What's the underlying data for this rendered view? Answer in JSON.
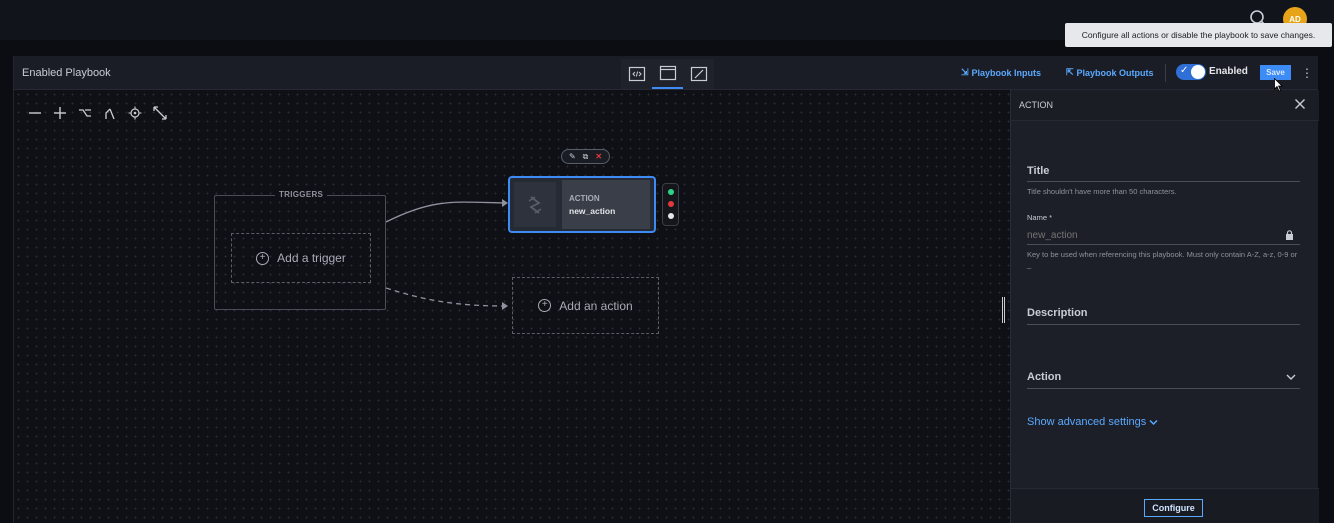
{
  "topbar": {
    "avatar_initials": "AD"
  },
  "header": {
    "title": "Enabled Playbook",
    "playbook_inputs_label": "Playbook Inputs",
    "playbook_outputs_label": "Playbook Outputs",
    "enabled_label": "Enabled",
    "enabled": true,
    "save_label": "Save",
    "tooltip": "Configure all actions or disable the playbook to save changes."
  },
  "canvas": {
    "triggers_label": "TRIGGERS",
    "add_trigger_label": "Add a trigger",
    "add_action_label": "Add an action",
    "node": {
      "type_label": "ACTION",
      "name": "new_action"
    }
  },
  "panel": {
    "title": "ACTION",
    "title_field_label": "Title",
    "title_hint": "Title shouldn't have more than 50 characters.",
    "name_label": "Name *",
    "name_placeholder": "new_action",
    "name_hint": "Key to be used when referencing this playbook. Must only contain A-Z, a-z, 0-9 or _",
    "description_label": "Description",
    "action_label": "Action",
    "advanced_label": "Show advanced settings",
    "configure_label": "Configure"
  },
  "colors": {
    "accent": "#3d8bf5",
    "link": "#5aa9ff",
    "avatar": "#e8a418",
    "success": "#2bd48a",
    "error": "#e5383b"
  }
}
